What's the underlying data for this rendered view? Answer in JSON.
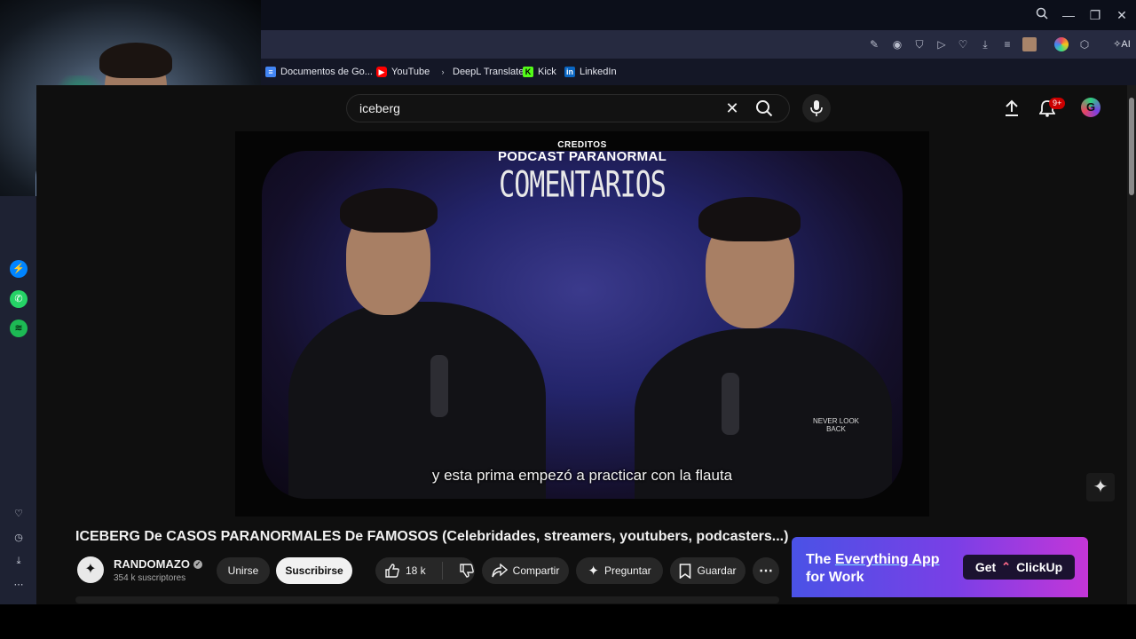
{
  "browser": {
    "bookmarks": [
      {
        "label": "Documentos de Go...",
        "icon": "docs-icon",
        "color": "#4285f4"
      },
      {
        "label": "YouTube",
        "icon": "youtube-icon",
        "color": "#ff0000"
      },
      {
        "label": "DeepL Translate",
        "icon": "deepl-icon",
        "color": "#0f2b46"
      },
      {
        "label": "Kick",
        "icon": "kick-icon",
        "color": "#53fc18"
      },
      {
        "label": "LinkedIn",
        "icon": "linkedin-icon",
        "color": "#0a66c2"
      }
    ],
    "ai_label": "AI",
    "window_controls": [
      "search-icon",
      "minimize-icon",
      "restore-icon",
      "close-icon"
    ]
  },
  "sidebar": {
    "apps": [
      {
        "name": "messenger-icon",
        "color": "#0084ff"
      },
      {
        "name": "whatsapp-icon",
        "color": "#25d366"
      },
      {
        "name": "spotify-icon",
        "color": "#1db954"
      }
    ],
    "bottom": [
      "heart-icon",
      "clock-icon",
      "download-icon",
      "more-icon"
    ]
  },
  "youtube": {
    "search_value": "iceberg",
    "notification_count": "9+",
    "video": {
      "overlay_small": "CREDITOS",
      "overlay_title": "PODCAST PARANORMAL",
      "overlay_sub": "COMENTARIOS",
      "subtitle": "y esta prima empezó a practicar con la flauta",
      "shirt_text": "NEVER LOOK BACK"
    },
    "title": "ICEBERG De CASOS PARANORMALES De FAMOSOS (Celebridades, streamers, youtubers, podcasters...)",
    "channel": {
      "name": "RANDOMAZO",
      "subscribers": "354 k suscriptores",
      "join_label": "Unirse",
      "subscribe_label": "Suscribirse"
    },
    "actions": {
      "likes": "18 k",
      "share_label": "Compartir",
      "ask_label": "Preguntar",
      "save_label": "Guardar"
    },
    "ad": {
      "line1_prefix": "The ",
      "line1_highlight": "Everything App",
      "line2": "for Work",
      "cta_prefix": "Get",
      "cta_brand": "ClickUp"
    }
  },
  "colors": {
    "subscribe_bg": "#f1f1f1",
    "notification_badge": "#cc0000",
    "accent": "#3ea6ff"
  }
}
